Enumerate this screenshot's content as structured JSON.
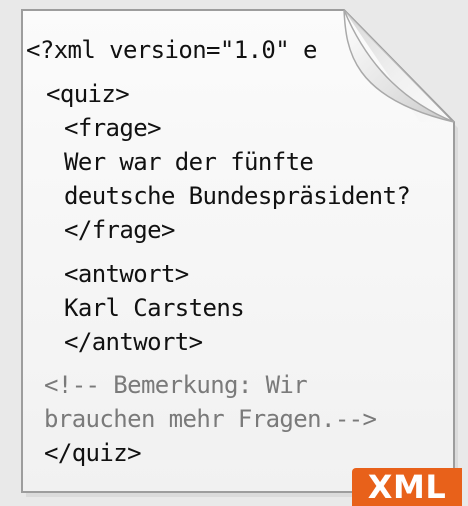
{
  "document": {
    "lines": [
      "<?xml version=\"1.0\" e",
      "<quiz>",
      "<frage>",
      "Wer war der fünfte",
      "deutsche Bundespräsident?",
      "</frage>",
      "<antwort>",
      "Karl Carstens",
      "</antwort>",
      "<!-- Bemerkung: Wir",
      "brauchen mehr Fragen.-->",
      "</quiz>"
    ]
  },
  "badge": {
    "label": "XML",
    "color": "#e8611a"
  },
  "colors": {
    "background": "#e9e9e9",
    "paper": "#f7f7f7",
    "text": "#111111",
    "comment": "#7a7a7a"
  },
  "icons": [
    "document-icon",
    "folded-corner-icon",
    "xml-badge"
  ]
}
